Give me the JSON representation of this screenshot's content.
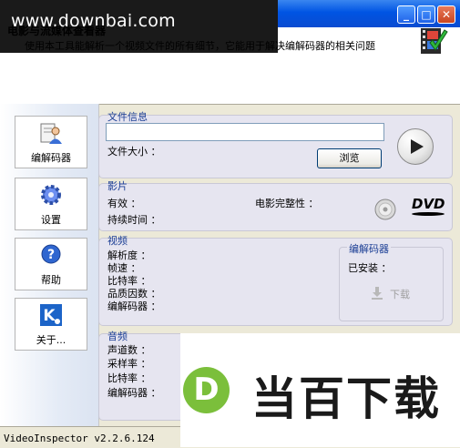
{
  "watermark": {
    "banner_text": "www.downbai.com",
    "logo_letter": "D",
    "logo_text": "当百下载"
  },
  "window": {
    "minimize": "_",
    "maximize": "□",
    "close": "✕"
  },
  "header": {
    "heading": "电影与流媒体查看器",
    "description": "使用本工具能解析一个视频文件的所有细节，它能用于解决编解码器的相关问题"
  },
  "sidebar": {
    "items": [
      {
        "label": "编解码器",
        "icon": "codec-person-icon"
      },
      {
        "label": "设置",
        "icon": "gear-icon"
      },
      {
        "label": "帮助",
        "icon": "help-icon"
      },
      {
        "label": "关于...",
        "icon": "about-k-icon"
      }
    ]
  },
  "file_info": {
    "legend": "文件信息",
    "file_path_value": "",
    "size_label": "文件大小 ：",
    "browse_label": "浏览"
  },
  "movie": {
    "legend": "影片",
    "valid_label": "有效 ：",
    "duration_label": "持续时间 ：",
    "integrity_label": "电影完整性 ：",
    "dvd_label": "DVD"
  },
  "video": {
    "legend": "视频",
    "resolution_label": "解析度 ：",
    "framerate_label": "帧速 ：",
    "bitrate_label": "比特率 ：",
    "quality_label": "品质因数 ：",
    "codec_label": "编解码器 ：",
    "codec_box": {
      "legend": "编解码器",
      "installed_label": "已安装 ：",
      "download_label": "下载"
    }
  },
  "audio": {
    "legend": "音频",
    "channels_label": "声道数 ：",
    "samplerate_label": "采样率 ：",
    "bitrate_label": "比特率 ：",
    "codec_label": "编解码器 ："
  },
  "status": {
    "version": "VideoInspector v2.2.6.124"
  },
  "colors": {
    "legend": "#1c3f95",
    "panel": "#e6e5f0",
    "logo_green": "#7bbf3b",
    "titlebar": "#0054e3"
  }
}
